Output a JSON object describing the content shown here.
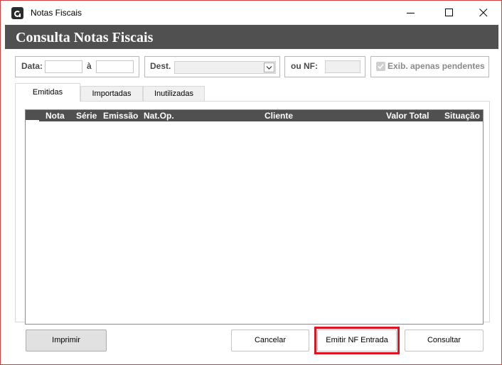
{
  "window": {
    "title": "Notas Fiscais",
    "controls": [
      "minimize-icon",
      "maximize-icon",
      "close-icon"
    ]
  },
  "header": {
    "title": "Consulta Notas Fiscais"
  },
  "filters": {
    "data_label": "Data:",
    "data_from_value": "",
    "range_sep": "à",
    "data_to_value": "",
    "dest_label": "Dest.",
    "dest_selected": "",
    "nf_label": "ou NF:",
    "nf_value": "",
    "pending_label": "Exib. apenas pendentes",
    "pending_checked": true
  },
  "tabs": [
    {
      "label": "Emitidas",
      "active": true
    },
    {
      "label": "Importadas",
      "active": false
    },
    {
      "label": "Inutilizadas",
      "active": false
    }
  ],
  "grid": {
    "columns": [
      "Nota",
      "Série",
      "Emissão",
      "Nat.Op.",
      "Cliente",
      "Valor Total",
      "Situação"
    ],
    "rows": []
  },
  "buttons": {
    "imprimir": "Imprimir",
    "cancelar": "Cancelar",
    "emitir_nf_entrada": "Emitir NF Entrada",
    "consultar": "Consultar"
  },
  "colors": {
    "header_bg": "#505050",
    "highlight": "#e0141e",
    "window_border": "#d33c3c"
  }
}
